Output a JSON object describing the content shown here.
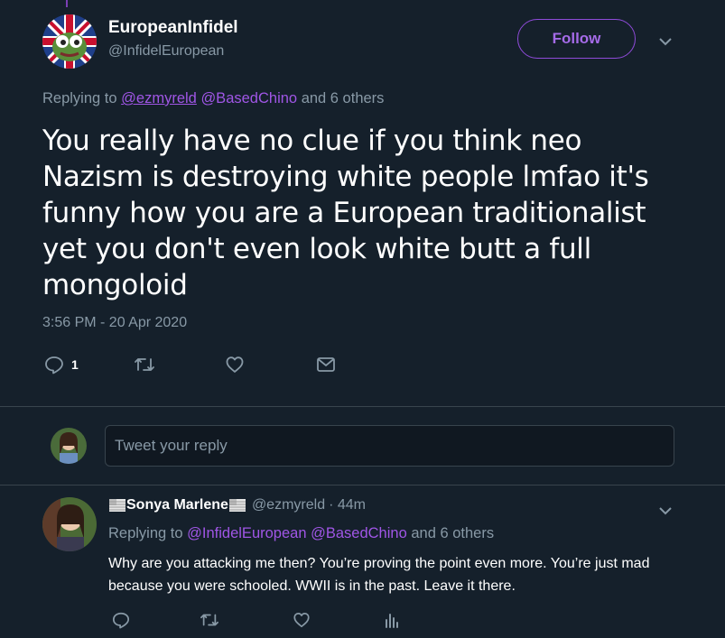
{
  "main_tweet": {
    "display_name": "EuropeanInfidel",
    "handle": "@InfidelEuropean",
    "follow_label": "Follow",
    "replying_prefix": "Replying to",
    "replying_user_1": "@ezmyreld",
    "replying_user_2": "@BasedChino",
    "replying_suffix": "and 6 others",
    "text": "You really have no clue if you think neo Nazism is destroying white people lmfao it's funny how you are a European traditionalist yet you don't even look white butt a full mongoloid",
    "timestamp": "3:56 PM - 20 Apr 2020",
    "reply_count": "1",
    "icons": [
      "reply-icon",
      "retweet-icon",
      "like-icon",
      "message-icon",
      "chevron-down-icon"
    ]
  },
  "reply_box": {
    "placeholder": "Tweet your reply"
  },
  "reply_tweet": {
    "display_name": "Sonya Marlene",
    "handle": "@ezmyreld",
    "time": "· 44m",
    "replying_prefix": "Replying to",
    "replying_user_1": "@InfidelEuropean",
    "replying_user_2": "@BasedChino",
    "replying_suffix": "and 6 others",
    "text": "Why are you attacking me then? You’re proving the point even more. You’re just mad because you were schooled. WWII is in the past. Leave it there.",
    "icons": [
      "reply-icon",
      "retweet-icon",
      "like-icon",
      "analytics-icon",
      "chevron-down-icon",
      "flag-icon"
    ]
  },
  "colors": {
    "background": "#15202b",
    "accent": "#a056e6",
    "muted": "#8899a6",
    "divider": "#38444d"
  }
}
